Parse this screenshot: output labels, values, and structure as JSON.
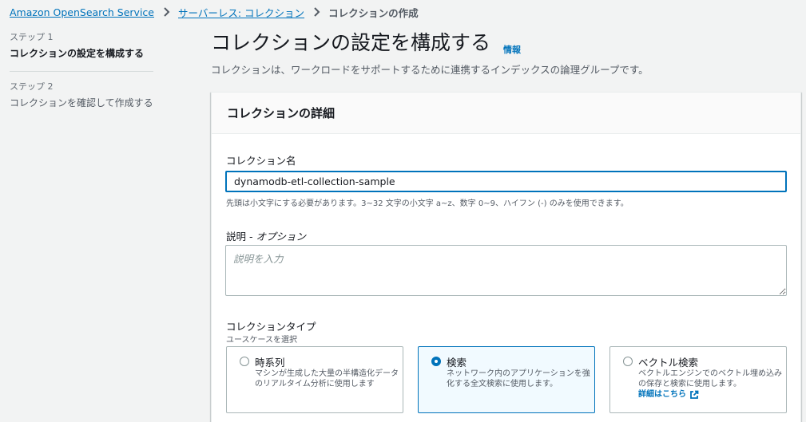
{
  "breadcrumb": {
    "items": [
      "Amazon OpenSearch Service",
      "サーバーレス: コレクション"
    ],
    "current": "コレクションの作成"
  },
  "steps": {
    "step1_num": "ステップ 1",
    "step1_title": "コレクションの設定を構成する",
    "step2_num": "ステップ 2",
    "step2_title": "コレクションを確認して作成する"
  },
  "header": {
    "title": "コレクションの設定を構成する",
    "info_link": "情報",
    "description": "コレクションは、ワークロードをサポートするために連携するインデックスの論理グループです。"
  },
  "panel": {
    "title": "コレクションの詳細",
    "name_label": "コレクション名",
    "name_value": "dynamodb-etl-collection-sample",
    "name_constraint": "先頭は小文字にする必要があります。3~32 文字の小文字 a~z、数字 0~9、ハイフン (-) のみを使用できます。",
    "desc_label": "説明 - ",
    "desc_optional": "オプション",
    "desc_placeholder": "説明を入力",
    "type_label": "コレクションタイプ",
    "type_sublabel": "ユースケースを選択",
    "types": [
      {
        "title": "時系列",
        "desc": "マシンが生成した大量の半構造化データのリアルタイム分析に使用します",
        "selected": false
      },
      {
        "title": "検索",
        "desc": "ネットワーク内のアプリケーションを強化する全文検索に使用します。",
        "selected": true
      },
      {
        "title": "ベクトル検索",
        "desc": "ベクトルエンジンでのベクトル埋め込みの保存と検索に使用します。",
        "link": "詳細はこちら",
        "selected": false
      }
    ]
  },
  "icons": {
    "separator": "chevron-right-icon",
    "external": "external-link-icon"
  },
  "colors": {
    "link": "#0073bb",
    "selected_bg": "#f1faff",
    "page_bg": "#f2f3f3"
  }
}
